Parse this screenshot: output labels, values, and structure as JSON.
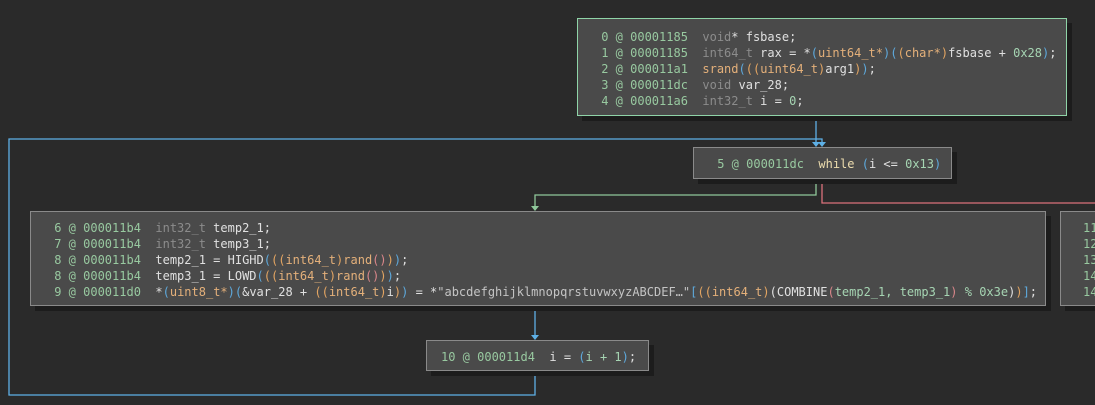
{
  "colors": {
    "true_edge": "#8fc89a",
    "false_edge": "#d9707a",
    "loop_edge": "#5eb0e6",
    "background": "#2a2a2a",
    "block": "#4a4a4a"
  },
  "blocks": [
    {
      "id": "block-entry",
      "lines": [
        [
          [
            " 0 @ 00001185  ",
            "n"
          ],
          [
            "void",
            "t"
          ],
          [
            "* fsbase;",
            "v"
          ]
        ],
        [
          [
            " 1 @ 00001185  ",
            "n"
          ],
          [
            "int64_t",
            "t"
          ],
          [
            " rax = *",
            "v"
          ],
          [
            "(",
            "p1"
          ],
          [
            "uint64_t*",
            "f"
          ],
          [
            ")",
            "p1"
          ],
          [
            "(",
            "p1"
          ],
          [
            "(",
            "p2"
          ],
          [
            "char*",
            "f"
          ],
          [
            ")",
            "p2"
          ],
          [
            "fsbase + ",
            "v"
          ],
          [
            "0x28",
            "c"
          ],
          [
            ")",
            "p1"
          ],
          [
            ";",
            "v"
          ]
        ],
        [
          [
            " 2 @ 000011a1  ",
            "n"
          ],
          [
            "srand",
            "f"
          ],
          [
            "(",
            "p1"
          ],
          [
            "(",
            "p2"
          ],
          [
            "(",
            "p2"
          ],
          [
            "uint64_t",
            "f"
          ],
          [
            ")",
            "p2"
          ],
          [
            "arg1",
            "v"
          ],
          [
            ")",
            "p2"
          ],
          [
            ")",
            "p1"
          ],
          [
            ";",
            "v"
          ]
        ],
        [
          [
            " 3 @ 000011dc  ",
            "n"
          ],
          [
            "void",
            "t"
          ],
          [
            " var_28;",
            "v"
          ]
        ],
        [
          [
            " 4 @ 000011a6  ",
            "n"
          ],
          [
            "int32_t",
            "t"
          ],
          [
            " i = ",
            "v"
          ],
          [
            "0",
            "c"
          ],
          [
            ";",
            "v"
          ]
        ]
      ]
    },
    {
      "id": "block-while",
      "lines": [
        [
          [
            " 5 @ 000011dc  ",
            "n"
          ],
          [
            "while",
            "k"
          ],
          [
            " ",
            "v"
          ],
          [
            "(",
            "p1"
          ],
          [
            "i <= ",
            "v"
          ],
          [
            "0x13",
            "c"
          ],
          [
            ")",
            "p1"
          ]
        ]
      ]
    },
    {
      "id": "block-body",
      "lines": [
        [
          [
            " 6 @ 000011b4  ",
            "n"
          ],
          [
            "int32_t",
            "t"
          ],
          [
            " temp2_1;",
            "v"
          ]
        ],
        [
          [
            " 7 @ 000011b4  ",
            "n"
          ],
          [
            "int32_t",
            "t"
          ],
          [
            " temp3_1;",
            "v"
          ]
        ],
        [
          [
            " 8 @ 000011b4  ",
            "n"
          ],
          [
            "temp2_1 = HIGHD",
            "v"
          ],
          [
            "(",
            "p1"
          ],
          [
            "(",
            "p2"
          ],
          [
            "(",
            "p2"
          ],
          [
            "int64_t",
            "f"
          ],
          [
            ")",
            "p2"
          ],
          [
            "rand",
            "f"
          ],
          [
            "()",
            "p3"
          ],
          [
            ")",
            "p2"
          ],
          [
            ")",
            "p1"
          ],
          [
            ";",
            "v"
          ]
        ],
        [
          [
            " 8 @ 000011b4  ",
            "n"
          ],
          [
            "temp3_1 = LOWD",
            "v"
          ],
          [
            "(",
            "p1"
          ],
          [
            "(",
            "p2"
          ],
          [
            "(",
            "p2"
          ],
          [
            "int64_t",
            "f"
          ],
          [
            ")",
            "p2"
          ],
          [
            "rand",
            "f"
          ],
          [
            "()",
            "p3"
          ],
          [
            ")",
            "p2"
          ],
          [
            ")",
            "p1"
          ],
          [
            ";",
            "v"
          ]
        ],
        [
          [
            " 9 @ 000011d0  ",
            "n"
          ],
          [
            "*",
            "v"
          ],
          [
            "(",
            "p1"
          ],
          [
            "uint8_t*",
            "f"
          ],
          [
            ")",
            "p1"
          ],
          [
            "(",
            "p1"
          ],
          [
            "&var_28 + ",
            "v"
          ],
          [
            "(",
            "p2"
          ],
          [
            "(",
            "p2"
          ],
          [
            "int64_t",
            "f"
          ],
          [
            ")",
            "p2"
          ],
          [
            "i",
            "v"
          ],
          [
            ")",
            "p2"
          ],
          [
            ")",
            "p1"
          ],
          [
            " = *",
            "v"
          ],
          [
            "\"abcdefghijklmnopqrstuvwxyzABCDEF…\"",
            "s"
          ],
          [
            "[",
            "p1"
          ],
          [
            "(",
            "p2"
          ],
          [
            "(",
            "p2"
          ],
          [
            "int64_t",
            "f"
          ],
          [
            ")",
            "p2"
          ],
          [
            "(",
            "v"
          ],
          [
            "COMBINE",
            "v"
          ],
          [
            "(",
            "p3"
          ],
          [
            "temp2_1, temp3_1",
            "c"
          ],
          [
            ")",
            "p3"
          ],
          [
            " % 0x3e",
            "c"
          ],
          [
            ")",
            "v"
          ],
          [
            ")",
            "p2"
          ],
          [
            "]",
            "p1"
          ],
          [
            ";",
            "v"
          ]
        ]
      ]
    },
    {
      "id": "block-increment",
      "lines": [
        [
          [
            "10 @ 000011d4  ",
            "n"
          ],
          [
            "i = ",
            "v"
          ],
          [
            "(",
            "p1"
          ],
          [
            "i + 1",
            "c"
          ],
          [
            ")",
            "p1"
          ],
          [
            ";",
            "v"
          ]
        ]
      ]
    },
    {
      "id": "block-exit-partial",
      "lines": [
        [
          [
            "11",
            "n"
          ]
        ],
        [
          [
            "12",
            "n"
          ]
        ],
        [
          [
            "13",
            "n"
          ]
        ],
        [
          [
            "14",
            "n"
          ]
        ],
        [
          [
            "14",
            "n"
          ]
        ]
      ]
    }
  ]
}
